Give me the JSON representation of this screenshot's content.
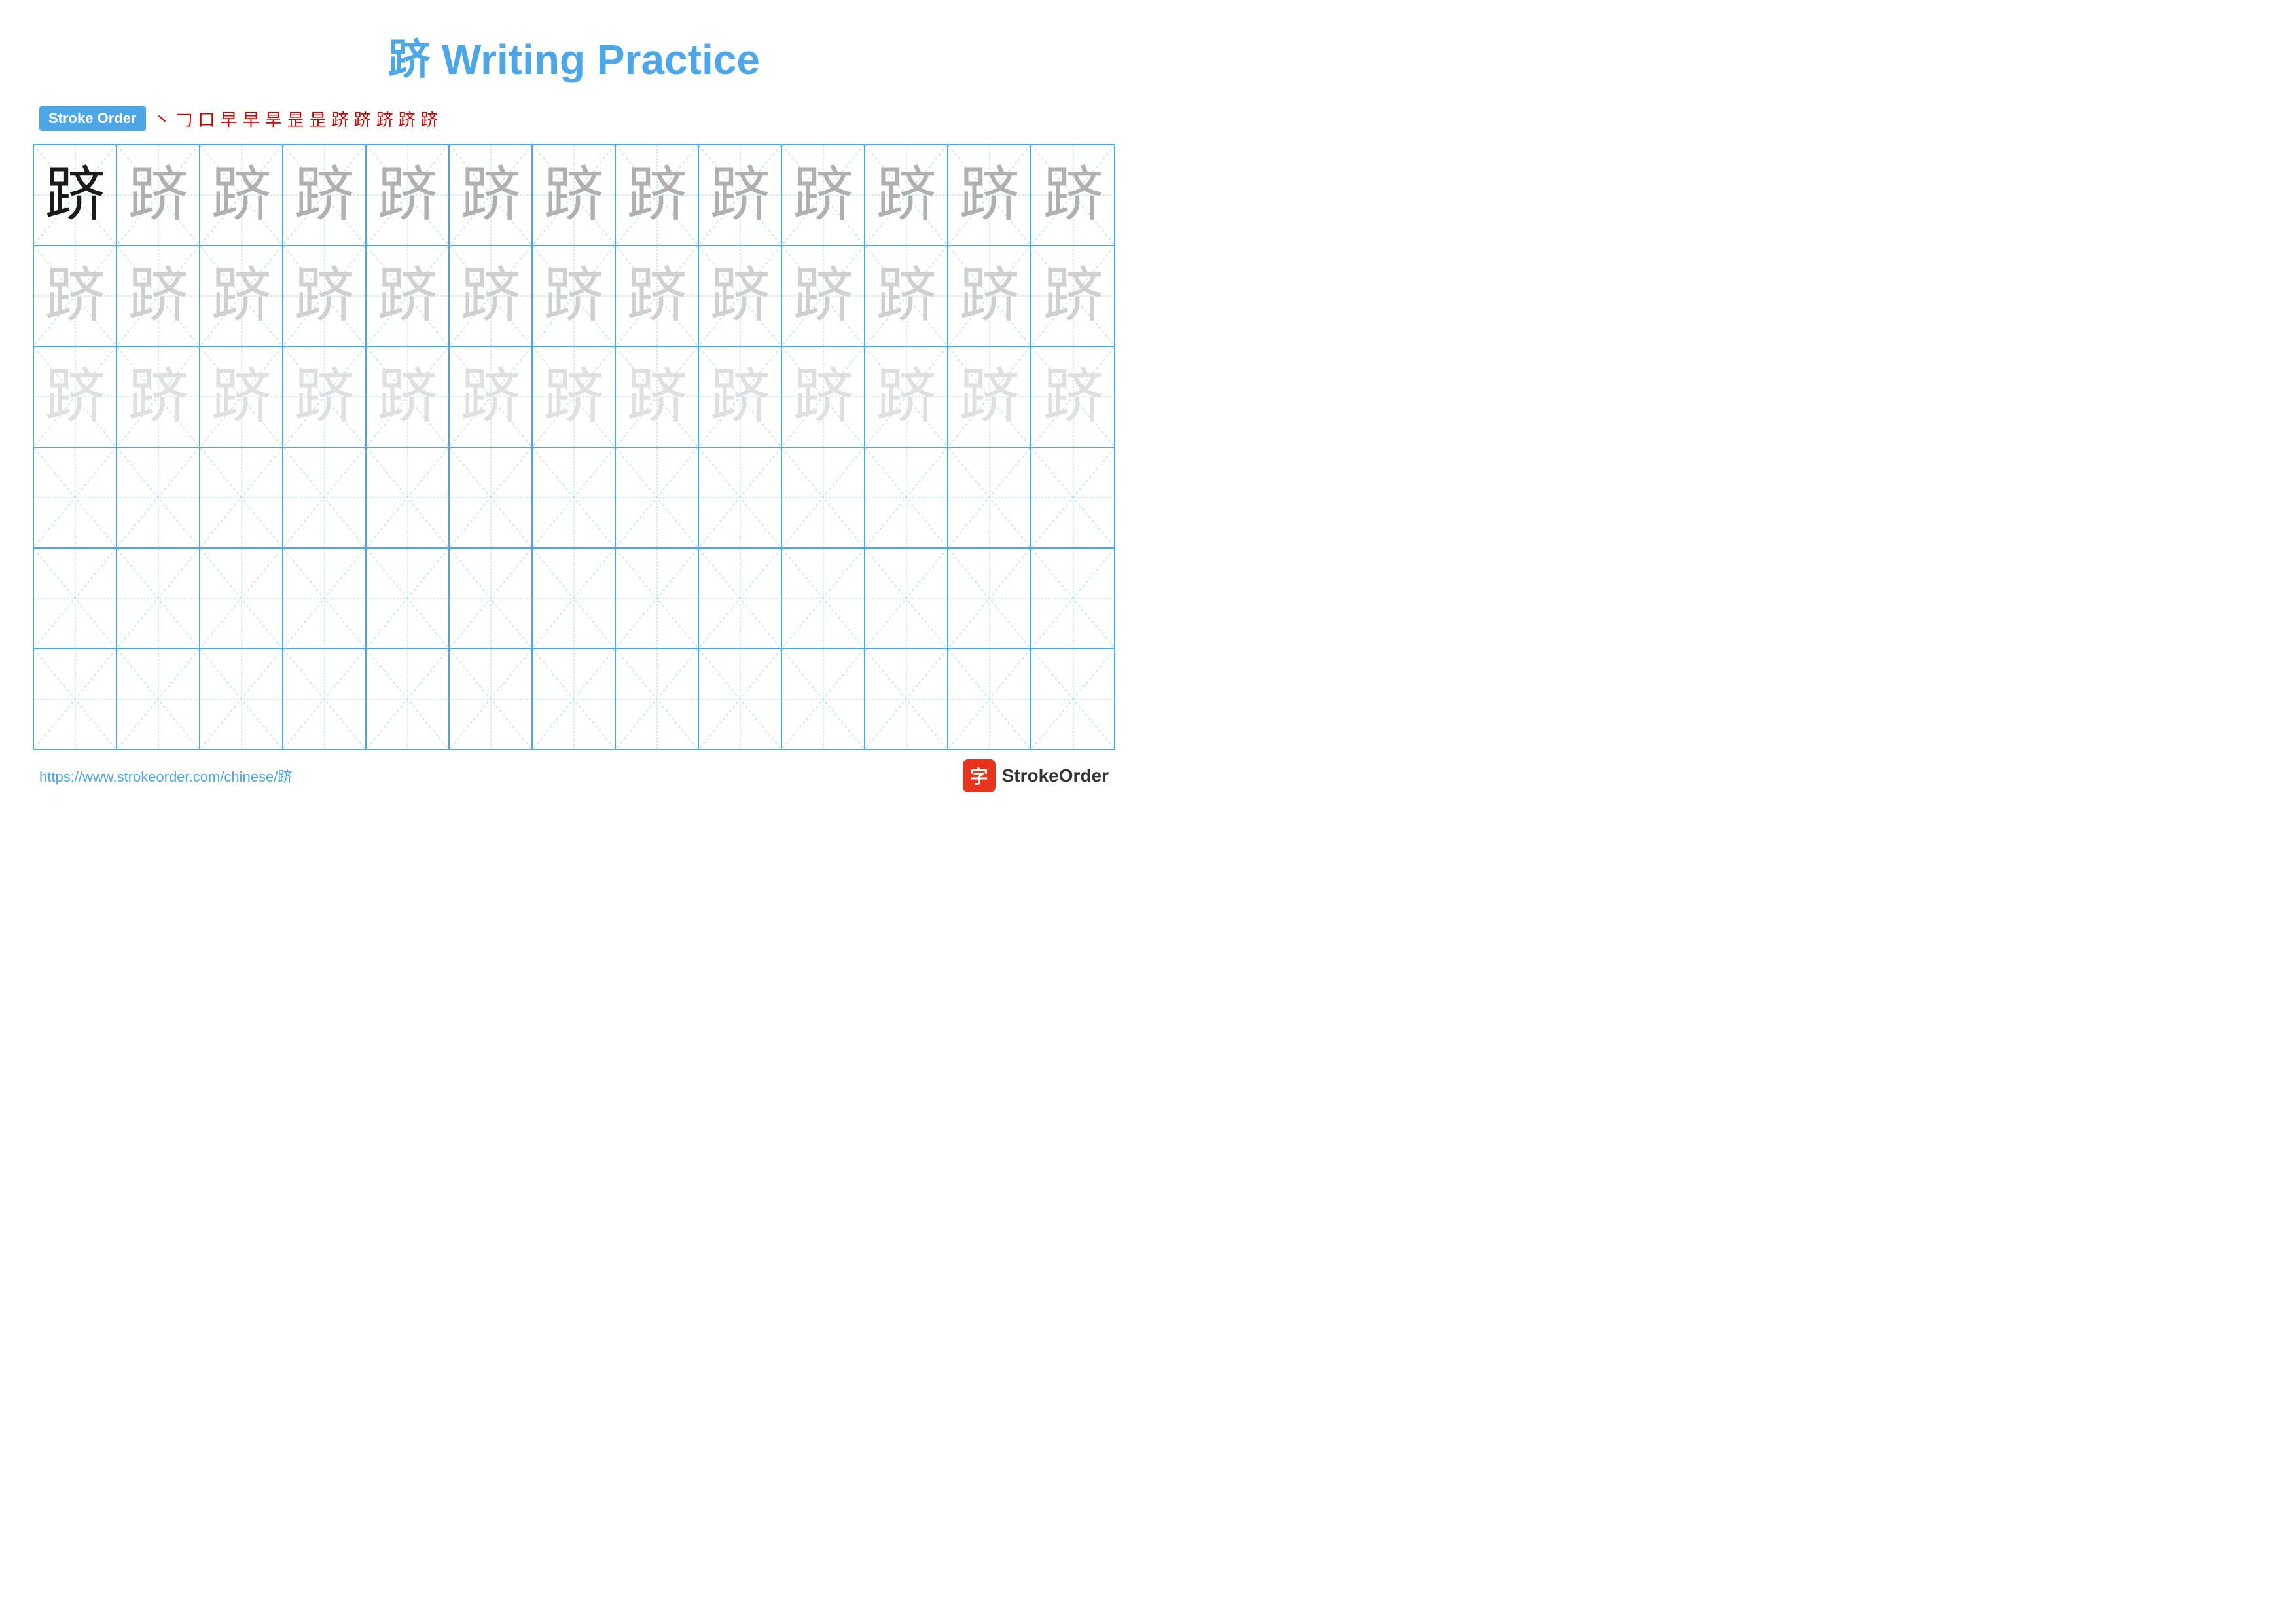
{
  "title": "跻 Writing Practice",
  "stroke_order": {
    "label": "Stroke Order",
    "strokes": [
      "丶",
      "⻌",
      "口",
      "⻊",
      "早",
      "旱",
      "昰",
      "昰`",
      "跻̄",
      "跻丿",
      "跻丨",
      "跻㇏",
      "跻"
    ]
  },
  "character": "跻",
  "grid": {
    "rows": 6,
    "cols": 13
  },
  "footer": {
    "url": "https://www.strokeorder.com/chinese/跻",
    "logo_text": "StrokeOrder",
    "logo_icon": "字"
  }
}
